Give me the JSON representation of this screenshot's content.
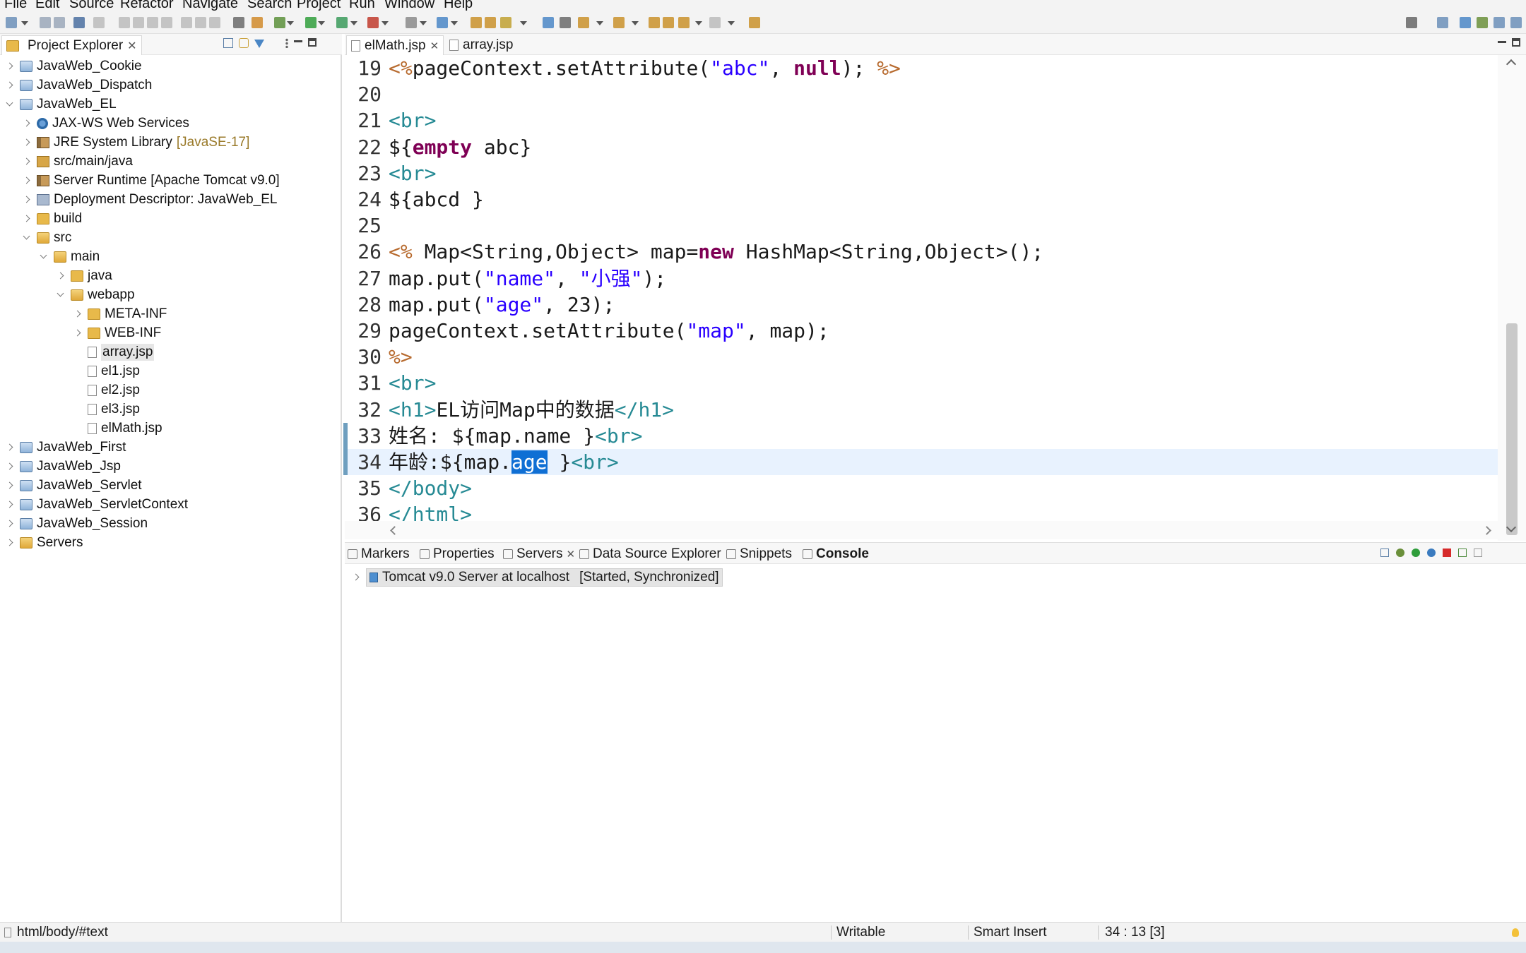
{
  "menu": [
    "File",
    "Edit",
    "Source",
    "Refactor",
    "Navigate",
    "Search",
    "Project",
    "Run",
    "Window",
    "Help"
  ],
  "project_explorer": {
    "tab_label": "Project Explorer",
    "tree": [
      {
        "label": "JavaWeb_Cookie",
        "indent": 0,
        "expander": "right",
        "icon": "project-icon"
      },
      {
        "label": "JavaWeb_Dispatch",
        "indent": 0,
        "expander": "right",
        "icon": "project-icon"
      },
      {
        "label": "JavaWeb_EL",
        "indent": 0,
        "expander": "down",
        "icon": "project-icon"
      },
      {
        "label": "JAX-WS Web Services",
        "indent": 1,
        "expander": "right",
        "icon": "web-services-icon"
      },
      {
        "label": "JRE System Library",
        "suffix": "[JavaSE-17]",
        "indent": 1,
        "expander": "right",
        "icon": "library-icon"
      },
      {
        "label": "src/main/java",
        "indent": 1,
        "expander": "right",
        "icon": "package-folder-icon"
      },
      {
        "label": "Server Runtime [Apache Tomcat v9.0]",
        "indent": 1,
        "expander": "right",
        "icon": "library-icon"
      },
      {
        "label": "Deployment Descriptor: JavaWeb_EL",
        "indent": 1,
        "expander": "right",
        "icon": "descriptor-icon"
      },
      {
        "label": "build",
        "indent": 1,
        "expander": "right",
        "icon": "folder-icon"
      },
      {
        "label": "src",
        "indent": 1,
        "expander": "down",
        "icon": "folder-open-icon"
      },
      {
        "label": "main",
        "indent": 2,
        "expander": "down",
        "icon": "folder-open-icon"
      },
      {
        "label": "java",
        "indent": 3,
        "expander": "right",
        "icon": "folder-icon"
      },
      {
        "label": "webapp",
        "indent": 3,
        "expander": "down",
        "icon": "folder-open-icon"
      },
      {
        "label": "META-INF",
        "indent": 4,
        "expander": "right",
        "icon": "folder-icon"
      },
      {
        "label": "WEB-INF",
        "indent": 4,
        "expander": "right",
        "icon": "folder-icon"
      },
      {
        "label": "array.jsp",
        "indent": 4,
        "expander": "none",
        "icon": "file-icon",
        "selected": true
      },
      {
        "label": "el1.jsp",
        "indent": 4,
        "expander": "none",
        "icon": "file-icon"
      },
      {
        "label": "el2.jsp",
        "indent": 4,
        "expander": "none",
        "icon": "file-icon"
      },
      {
        "label": "el3.jsp",
        "indent": 4,
        "expander": "none",
        "icon": "file-icon"
      },
      {
        "label": "elMath.jsp",
        "indent": 4,
        "expander": "none",
        "icon": "file-icon"
      },
      {
        "label": "JavaWeb_First",
        "indent": 0,
        "expander": "right",
        "icon": "project-icon"
      },
      {
        "label": "JavaWeb_Jsp",
        "indent": 0,
        "expander": "right",
        "icon": "project-icon"
      },
      {
        "label": "JavaWeb_Servlet",
        "indent": 0,
        "expander": "right",
        "icon": "project-icon"
      },
      {
        "label": "JavaWeb_ServletContext",
        "indent": 0,
        "expander": "right",
        "icon": "project-icon"
      },
      {
        "label": "JavaWeb_Session",
        "indent": 0,
        "expander": "right",
        "icon": "project-icon"
      },
      {
        "label": "Servers",
        "indent": 0,
        "expander": "right",
        "icon": "folder-open-icon"
      }
    ]
  },
  "editor": {
    "tabs": [
      {
        "label": "elMath.jsp",
        "active": true,
        "closable": true
      },
      {
        "label": "array.jsp",
        "active": false,
        "closable": false
      }
    ],
    "lines": [
      {
        "n": "19",
        "segs": [
          [
            "scr",
            "<%"
          ],
          [
            "",
            "pageContext.setAttribute("
          ],
          [
            "str",
            "\"abc\""
          ],
          [
            "",
            ", "
          ],
          [
            "kw",
            "null"
          ],
          [
            "",
            "); "
          ],
          [
            "scr",
            "%>"
          ]
        ]
      },
      {
        "n": "20",
        "segs": []
      },
      {
        "n": "21",
        "segs": [
          [
            "tag",
            "<br>"
          ]
        ]
      },
      {
        "n": "22",
        "segs": [
          [
            "",
            "${"
          ],
          [
            "kw",
            "empty"
          ],
          [
            "",
            " abc}"
          ]
        ]
      },
      {
        "n": "23",
        "segs": [
          [
            "tag",
            "<br>"
          ]
        ]
      },
      {
        "n": "24",
        "segs": [
          [
            "",
            "${abcd }"
          ]
        ]
      },
      {
        "n": "25",
        "segs": []
      },
      {
        "n": "26",
        "segs": [
          [
            "scr",
            "<%"
          ],
          [
            "",
            " Map<String,Object> map="
          ],
          [
            "kw",
            "new"
          ],
          [
            "",
            " HashMap<String,Object>();"
          ]
        ]
      },
      {
        "n": "27",
        "segs": [
          [
            "",
            "map.put("
          ],
          [
            "str",
            "\"name\""
          ],
          [
            "",
            ", "
          ],
          [
            "str",
            "\"小强\""
          ],
          [
            "",
            ");"
          ]
        ]
      },
      {
        "n": "28",
        "segs": [
          [
            "",
            "map.put("
          ],
          [
            "str",
            "\"age\""
          ],
          [
            "",
            ", 23);"
          ]
        ]
      },
      {
        "n": "29",
        "segs": [
          [
            "",
            "pageContext.setAttribute("
          ],
          [
            "str",
            "\"map\""
          ],
          [
            "",
            ", map);"
          ]
        ]
      },
      {
        "n": "30",
        "segs": [
          [
            "scr",
            "%>"
          ]
        ]
      },
      {
        "n": "31",
        "segs": [
          [
            "tag",
            "<br>"
          ]
        ]
      },
      {
        "n": "32",
        "segs": [
          [
            "tag",
            "<h1>"
          ],
          [
            "",
            "EL访问Map中的数据"
          ],
          [
            "tag",
            "</h1>"
          ]
        ]
      },
      {
        "n": "33",
        "segs": [
          [
            "",
            "姓名: ${map.name }"
          ],
          [
            "tag",
            "<br>"
          ]
        ]
      },
      {
        "n": "34",
        "current": true,
        "segs": [
          [
            "",
            "年龄:${map."
          ],
          [
            "hl",
            "age"
          ],
          [
            "",
            " }"
          ],
          [
            "tag",
            "<br>"
          ]
        ]
      },
      {
        "n": "35",
        "segs": [
          [
            "tag",
            "</body>"
          ]
        ]
      },
      {
        "n": "36",
        "segs": [
          [
            "tag",
            "</html>"
          ]
        ]
      }
    ]
  },
  "bottom_panel": {
    "tabs": [
      "Markers",
      "Properties",
      "Servers",
      "Data Source Explorer",
      "Snippets",
      "Console"
    ],
    "server_entry": "Tomcat v9.0 Server at localhost",
    "server_state": "[Started, Synchronized]"
  },
  "status": {
    "path": "html/body/#text",
    "writable": "Writable",
    "insert_mode": "Smart Insert",
    "position": "34 : 13 [3]"
  }
}
